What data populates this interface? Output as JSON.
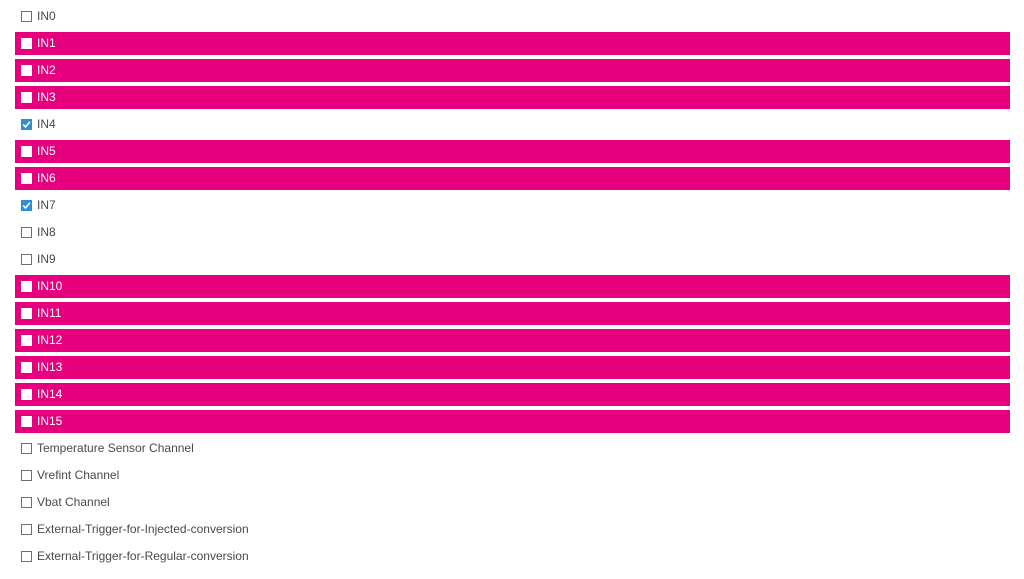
{
  "colors": {
    "highlight": "#e6007e",
    "check": "#2f8fd6",
    "text": "#4a4a4a"
  },
  "channels": [
    {
      "label": "IN0",
      "checked": false,
      "highlighted": false
    },
    {
      "label": "IN1",
      "checked": false,
      "highlighted": true
    },
    {
      "label": "IN2",
      "checked": false,
      "highlighted": true
    },
    {
      "label": "IN3",
      "checked": false,
      "highlighted": true
    },
    {
      "label": "IN4",
      "checked": true,
      "highlighted": false
    },
    {
      "label": "IN5",
      "checked": false,
      "highlighted": true
    },
    {
      "label": "IN6",
      "checked": false,
      "highlighted": true
    },
    {
      "label": "IN7",
      "checked": true,
      "highlighted": false
    },
    {
      "label": "IN8",
      "checked": false,
      "highlighted": false
    },
    {
      "label": "IN9",
      "checked": false,
      "highlighted": false
    },
    {
      "label": "IN10",
      "checked": false,
      "highlighted": true
    },
    {
      "label": "IN11",
      "checked": false,
      "highlighted": true
    },
    {
      "label": "IN12",
      "checked": false,
      "highlighted": true
    },
    {
      "label": "IN13",
      "checked": false,
      "highlighted": true
    },
    {
      "label": "IN14",
      "checked": false,
      "highlighted": true
    },
    {
      "label": "IN15",
      "checked": false,
      "highlighted": true
    },
    {
      "label": "Temperature Sensor Channel",
      "checked": false,
      "highlighted": false
    },
    {
      "label": "Vrefint Channel",
      "checked": false,
      "highlighted": false
    },
    {
      "label": "Vbat Channel",
      "checked": false,
      "highlighted": false
    },
    {
      "label": "External-Trigger-for-Injected-conversion",
      "checked": false,
      "highlighted": false
    },
    {
      "label": "External-Trigger-for-Regular-conversion",
      "checked": false,
      "highlighted": false
    }
  ]
}
